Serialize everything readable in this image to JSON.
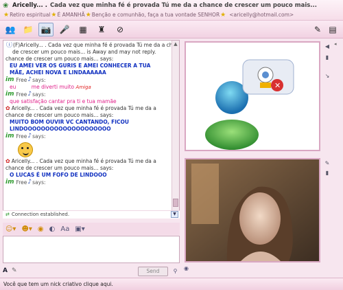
{
  "window": {
    "title_name": "Aricelly... .",
    "title_message": "Cada vez que minha fé é provada Tú me da a chance de crescer um pouco mais...",
    "sub_status_1": "Retiro espiritual",
    "sub_status_2": "É AMANHÃ",
    "sub_status_3": "Benção e comunhão, faça a tua vontade SENHOR",
    "sub_email": "<aricelly@hotmail.com>"
  },
  "toolbar": {
    "buttons": [
      "invite-contact",
      "send-files",
      "webcam",
      "audio",
      "activities",
      "games",
      "block"
    ],
    "right_buttons": [
      "paint",
      "menu"
    ]
  },
  "conversation": {
    "away_line_1": "(F)Aricelly... .  Cada vez que minha fé é provada Tú me da a chance",
    "away_line_2": "de crescer um pouco mais... is Away and may not reply.",
    "line_says_a": "chance de crescer um pouco mais... says:",
    "msg_1_line_1": "EU AMEI VER OS GURIS E AMEI CONHECER A TUA",
    "msg_1_line_2": "MÃE, ACHEI NOVA E LINDAAAAAA",
    "free_says_1": "Free",
    "says_label": "says:",
    "eu": "eu",
    "me_diverti": "me diverti muito",
    "amiga": "Amiga",
    "free_says_2": "Free",
    "pink_msg": "que satisfação cantar pra ti e tua mamãe",
    "aricelly_line_1": "Aricelly... .  Cada vez que minha fé é provada Tú me da a",
    "aricelly_line_2": "chance de crescer um pouco mais... says:",
    "msg_2_line_1": "MUITO BOM OUVIR VC CANTANDO, FICOU",
    "msg_2_line_2": "LINDOOOOOOOOOOOOOOOOOOOO",
    "free_says_3": "Free",
    "aricelly_line_3": "Aricelly... .  Cada vez que minha fé é provada Tú me da a",
    "aricelly_line_4": "chance de crescer um pouco mais... says:",
    "msg_3": "O LUCAS É UM FOFO DE LINDOOO",
    "free_says_4": "Free",
    "status": "Connection established."
  },
  "input": {
    "send_label": "Send"
  },
  "footer": {
    "text": "Você que tem um nick criativo clique aqui."
  },
  "colors": {
    "accent_pink": "#e0208a",
    "message_blue": "#1030c0",
    "msn_green": "#2d9a2d"
  }
}
